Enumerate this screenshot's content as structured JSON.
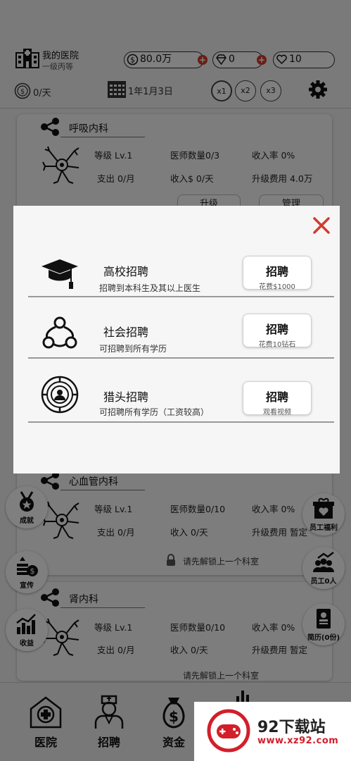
{
  "hospital": {
    "name": "我的医院",
    "level": "一级丙等"
  },
  "currency": {
    "money": "80.0万",
    "diamonds": "0",
    "hearts": "10"
  },
  "income": {
    "daily": "0/天"
  },
  "date": "1年1月3日",
  "speed": [
    "x1",
    "x2",
    "x3"
  ],
  "departments": [
    {
      "name": "呼吸内科",
      "level": "等级 Lv.1",
      "doctors": "医师数量0/3",
      "income_rate": "收入率 0%",
      "expense": "支出 0/月",
      "income": "收入$ 0/天",
      "upgrade_cost": "升级费用 4.0万",
      "buttons": [
        "升级",
        "管理"
      ]
    },
    {
      "name": "心血管内科",
      "level": "等级 Lv.1",
      "doctors": "医师数量0/10",
      "income_rate": "收入率 0%",
      "expense": "支出 0/月",
      "income": "收入 0/天",
      "upgrade_cost": "升级费用 暂定",
      "lock": "请先解锁上一个科室"
    },
    {
      "name": "肾内科",
      "level": "等级 Lv.1",
      "doctors": "医师数量0/10",
      "income_rate": "收入率 0%",
      "expense": "支出 0/月",
      "income": "收入 0/天",
      "upgrade_cost": "升级费用 暂定",
      "lock": "请先解锁上一个科室"
    }
  ],
  "left_side": [
    "成就",
    "宣传",
    "收益"
  ],
  "right_side": [
    "员工福利",
    "员工0人",
    "简历(0份)"
  ],
  "tabs": [
    "医院",
    "招聘",
    "资金"
  ],
  "modal": {
    "options": [
      {
        "icon": "graduation-cap-icon",
        "title": "高校招聘",
        "desc": "招聘到本科生及其以上医生",
        "btn": "招聘",
        "cost": "花费$1000"
      },
      {
        "icon": "social-network-icon",
        "title": "社会招聘",
        "desc": "可招聘到所有学历",
        "btn": "招聘",
        "cost": "花费10钻石"
      },
      {
        "icon": "headhunter-target-icon",
        "title": "猎头招聘",
        "desc": "可招聘所有学历（工资较高）",
        "btn": "招聘",
        "cost": "观看视频"
      }
    ]
  },
  "watermark": {
    "name": "92下载站",
    "url": "www.xz92.com"
  },
  "colors": {
    "accent_red": "#d43b2a",
    "watermark_red": "#d21f2a",
    "overlay": "rgba(0,0,0,0.5)"
  }
}
